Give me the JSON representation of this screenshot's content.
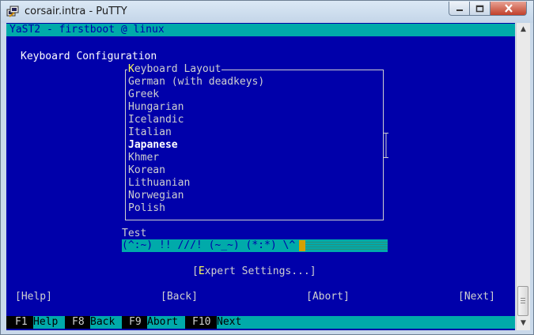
{
  "window": {
    "title": "corsair.intra - PuTTY"
  },
  "terminal": {
    "header": "YaST2 - firstboot @ linux",
    "page_title": "Keyboard Configuration",
    "list_title": "Keyboard Layout",
    "layouts": [
      "German (with deadkeys)",
      "Greek",
      "Hungarian",
      "Icelandic",
      "Italian",
      "Japanese",
      "Khmer",
      "Korean",
      "Lithuanian",
      "Norwegian",
      "Polish"
    ],
    "selected_layout": "Japanese",
    "test_label": "Test",
    "test_value": "(^:~) !! ///! (~_~) (*:*) \\^",
    "expert_button": "[Expert Settings...]",
    "buttons": {
      "help": "[Help]",
      "back": "[Back]",
      "abort": "[Abort]",
      "next": "[Next]"
    },
    "fkeys": [
      {
        "key": "F1",
        "label": "Help"
      },
      {
        "key": "F8",
        "label": "Back"
      },
      {
        "key": "F9",
        "label": "Abort"
      },
      {
        "key": "F10",
        "label": "Next"
      }
    ]
  },
  "colors": {
    "terminal_bg": "#0000aa",
    "terminal_fg": "#cfd0d0",
    "bar": "#00aaaa",
    "highlight": "#ffffff",
    "accent": "#ffff55"
  }
}
